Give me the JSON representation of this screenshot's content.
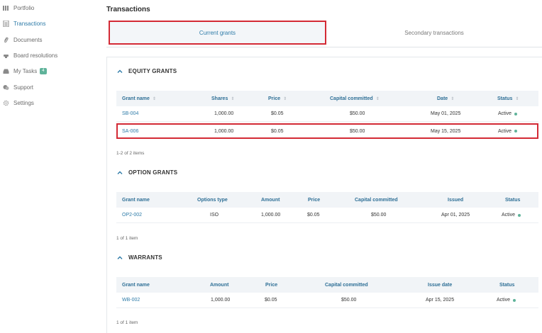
{
  "sidebar": {
    "items": [
      {
        "label": "Portfolio",
        "icon": "bars-icon"
      },
      {
        "label": "Transactions",
        "icon": "document-icon"
      },
      {
        "label": "Documents",
        "icon": "paperclip-icon"
      },
      {
        "label": "Board resolutions",
        "icon": "gavel-icon"
      },
      {
        "label": "My Tasks",
        "icon": "inbox-icon",
        "badge": "4"
      },
      {
        "label": "Support",
        "icon": "chat-icon"
      },
      {
        "label": "Settings",
        "icon": "gear-icon"
      }
    ]
  },
  "page": {
    "title": "Transactions"
  },
  "tabs": [
    {
      "label": "Current grants",
      "active": true
    },
    {
      "label": "Secondary transactions",
      "active": false
    }
  ],
  "equity": {
    "title": "EQUITY GRANTS",
    "columns": [
      "Grant name",
      "Shares",
      "Price",
      "Capital committed",
      "Date",
      "Status"
    ],
    "rows": [
      {
        "name": "SB-004",
        "shares": "1,000.00",
        "price": "$0.05",
        "capital": "$50.00",
        "date": "May 01, 2025",
        "status": "Active"
      },
      {
        "name": "SA-006",
        "shares": "1,000.00",
        "price": "$0.05",
        "capital": "$50.00",
        "date": "May 15, 2025",
        "status": "Active"
      }
    ],
    "count": "1-2 of 2 items"
  },
  "options": {
    "title": "OPTION GRANTS",
    "columns": [
      "Grant name",
      "Options type",
      "Amount",
      "Price",
      "Capital committed",
      "Issued",
      "Status"
    ],
    "rows": [
      {
        "name": "OP2-002",
        "type": "ISO",
        "amount": "1,000.00",
        "price": "$0.05",
        "capital": "$50.00",
        "issued": "Apr 01, 2025",
        "status": "Active"
      }
    ],
    "count": "1 of 1 item"
  },
  "warrants": {
    "title": "WARRANTS",
    "columns": [
      "Grant name",
      "Amount",
      "Price",
      "Capital committed",
      "Issue date",
      "Status"
    ],
    "rows": [
      {
        "name": "WB-002",
        "amount": "1,000.00",
        "price": "$0.05",
        "capital": "$50.00",
        "issue_date": "Apr 15, 2025",
        "status": "Active"
      }
    ],
    "count": "1 of 1 item"
  },
  "colors": {
    "accent": "#2e7ba8",
    "highlight": "#d32a35",
    "active_dot": "#5fb39a",
    "header_bg": "#f1f4f7"
  }
}
